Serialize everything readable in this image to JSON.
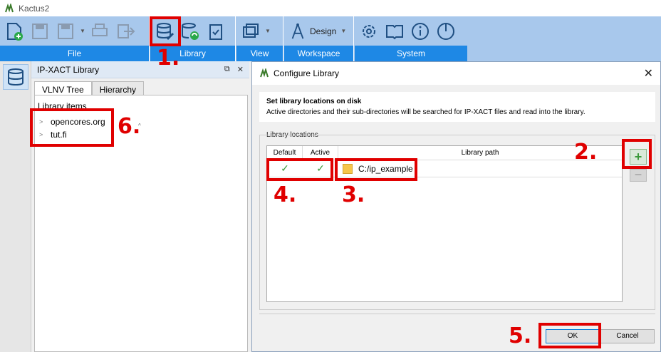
{
  "app": {
    "title": "Kactus2"
  },
  "ribbon": {
    "groups": [
      {
        "label": "File"
      },
      {
        "label": "Library"
      },
      {
        "label": "View"
      },
      {
        "label": "Workspace"
      },
      {
        "label": "System"
      }
    ],
    "workspace_value": "Design"
  },
  "library_panel": {
    "title": "IP-XACT Library",
    "tabs": [
      "VLNV Tree",
      "Hierarchy"
    ],
    "tree_title": "Library items",
    "items": [
      "opencores.org",
      "tut.fi"
    ]
  },
  "dialog": {
    "title": "Configure Library",
    "info_heading": "Set library locations on disk",
    "info_desc": "Active directories and their sub-directories will be searched for IP-XACT files and read into the library.",
    "locations_label": "Library locations",
    "columns": [
      "Default",
      "Active",
      "Library path"
    ],
    "rows": [
      {
        "default": "✓",
        "active": "✓",
        "path": "C:/ip_example"
      }
    ],
    "add_label": "+",
    "remove_label": "−",
    "ok_label": "OK",
    "cancel_label": "Cancel"
  },
  "annotations": [
    "1.",
    "2.",
    "3.",
    "4.",
    "5.",
    "6."
  ],
  "colors": {
    "ribbon": "#a8c8ec",
    "ribbon_label": "#1e88e5",
    "annotation": "#e00000"
  }
}
